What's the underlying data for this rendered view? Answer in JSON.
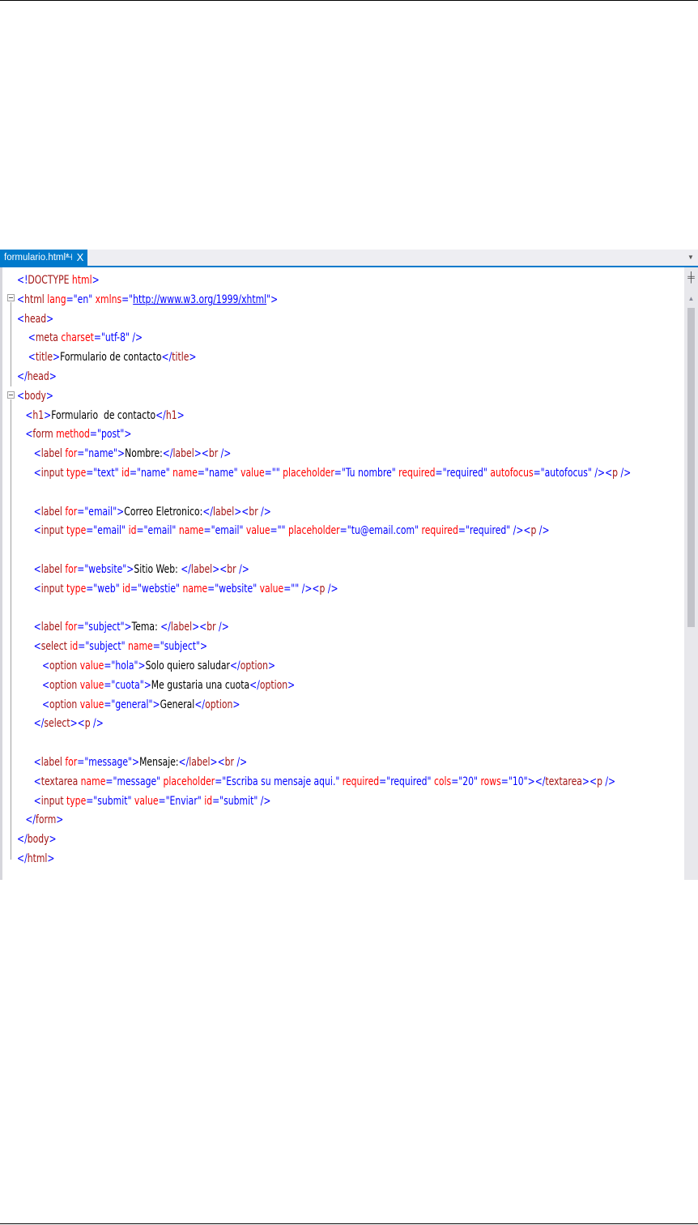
{
  "editor": {
    "tab": {
      "label": "formulario.html*",
      "pin_glyph": "⊣",
      "close_glyph": "X"
    },
    "tab_dropdown_glyph": "▼",
    "scrollbar": {
      "split_glyph": "╪",
      "up_glyph": "▲"
    }
  },
  "code_lines": [
    [
      [
        "p",
        "<!"
      ],
      [
        "t",
        "DOCTYPE"
      ],
      [
        "x",
        " "
      ],
      [
        "a",
        "html"
      ],
      [
        "p",
        ">"
      ]
    ],
    [
      [
        "p",
        "<"
      ],
      [
        "t",
        "html"
      ],
      [
        "x",
        " "
      ],
      [
        "a",
        "lang"
      ],
      [
        "p",
        "=\"en\""
      ],
      [
        "x",
        " "
      ],
      [
        "a",
        "xmlns"
      ],
      [
        "p",
        "=\""
      ],
      [
        "u",
        "http://www.w3.org/1999/xhtml"
      ],
      [
        "p",
        "\">"
      ]
    ],
    [
      [
        "p",
        "<"
      ],
      [
        "t",
        "head"
      ],
      [
        "p",
        ">"
      ]
    ],
    [
      [
        "x",
        "    "
      ],
      [
        "p",
        "<"
      ],
      [
        "t",
        "meta"
      ],
      [
        "x",
        " "
      ],
      [
        "a",
        "charset"
      ],
      [
        "p",
        "=\"utf-8\""
      ],
      [
        "x",
        " "
      ],
      [
        "p",
        "/>"
      ]
    ],
    [
      [
        "x",
        "    "
      ],
      [
        "p",
        "<"
      ],
      [
        "t",
        "title"
      ],
      [
        "p",
        ">"
      ],
      [
        "x",
        "Formulario de contacto"
      ],
      [
        "p",
        "</"
      ],
      [
        "t",
        "title"
      ],
      [
        "p",
        ">"
      ]
    ],
    [
      [
        "p",
        "</"
      ],
      [
        "t",
        "head"
      ],
      [
        "p",
        ">"
      ]
    ],
    [
      [
        "p",
        "<"
      ],
      [
        "t",
        "body"
      ],
      [
        "p",
        ">"
      ]
    ],
    [
      [
        "x",
        "   "
      ],
      [
        "p",
        "<"
      ],
      [
        "t",
        "h1"
      ],
      [
        "p",
        ">"
      ],
      [
        "x",
        "Formulario  de contacto"
      ],
      [
        "p",
        "</"
      ],
      [
        "t",
        "h1"
      ],
      [
        "p",
        ">"
      ]
    ],
    [
      [
        "x",
        "   "
      ],
      [
        "p",
        "<"
      ],
      [
        "t",
        "form"
      ],
      [
        "x",
        " "
      ],
      [
        "a",
        "method"
      ],
      [
        "p",
        "=\"post\">"
      ]
    ],
    [
      [
        "x",
        "      "
      ],
      [
        "p",
        "<"
      ],
      [
        "t",
        "label"
      ],
      [
        "x",
        " "
      ],
      [
        "a",
        "for"
      ],
      [
        "p",
        "=\"name\">"
      ],
      [
        "x",
        "Nombre:"
      ],
      [
        "p",
        "</"
      ],
      [
        "t",
        "label"
      ],
      [
        "p",
        "><"
      ],
      [
        "t",
        "br"
      ],
      [
        "x",
        " "
      ],
      [
        "p",
        "/>"
      ]
    ],
    [
      [
        "x",
        "      "
      ],
      [
        "p",
        "<"
      ],
      [
        "t",
        "input"
      ],
      [
        "x",
        " "
      ],
      [
        "a",
        "type"
      ],
      [
        "p",
        "=\"text\""
      ],
      [
        "x",
        " "
      ],
      [
        "a",
        "id"
      ],
      [
        "p",
        "=\"name\""
      ],
      [
        "x",
        " "
      ],
      [
        "a",
        "name"
      ],
      [
        "p",
        "=\"name\""
      ],
      [
        "x",
        " "
      ],
      [
        "a",
        "value"
      ],
      [
        "p",
        "=\"\""
      ],
      [
        "x",
        " "
      ],
      [
        "a",
        "placeholder"
      ],
      [
        "p",
        "=\"Tu nombre\""
      ],
      [
        "x",
        " "
      ],
      [
        "a",
        "required"
      ],
      [
        "p",
        "=\"required\""
      ],
      [
        "x",
        " "
      ],
      [
        "a",
        "autofocus"
      ],
      [
        "p",
        "=\"autofocus\""
      ],
      [
        "x",
        " "
      ],
      [
        "p",
        "/><"
      ],
      [
        "t",
        "p"
      ],
      [
        "x",
        " "
      ],
      [
        "p",
        "/>"
      ]
    ],
    [],
    [
      [
        "x",
        "      "
      ],
      [
        "p",
        "<"
      ],
      [
        "t",
        "label"
      ],
      [
        "x",
        " "
      ],
      [
        "a",
        "for"
      ],
      [
        "p",
        "=\"email\">"
      ],
      [
        "x",
        "Correo Eletronico:"
      ],
      [
        "p",
        "</"
      ],
      [
        "t",
        "label"
      ],
      [
        "p",
        "><"
      ],
      [
        "t",
        "br"
      ],
      [
        "x",
        " "
      ],
      [
        "p",
        "/>"
      ]
    ],
    [
      [
        "x",
        "      "
      ],
      [
        "p",
        "<"
      ],
      [
        "t",
        "input"
      ],
      [
        "x",
        " "
      ],
      [
        "a",
        "type"
      ],
      [
        "p",
        "=\"email\""
      ],
      [
        "x",
        " "
      ],
      [
        "a",
        "id"
      ],
      [
        "p",
        "=\"email\""
      ],
      [
        "x",
        " "
      ],
      [
        "a",
        "name"
      ],
      [
        "p",
        "=\"email\""
      ],
      [
        "x",
        " "
      ],
      [
        "a",
        "value"
      ],
      [
        "p",
        "=\"\""
      ],
      [
        "x",
        " "
      ],
      [
        "a",
        "placeholder"
      ],
      [
        "p",
        "=\"tu@email.com\""
      ],
      [
        "x",
        " "
      ],
      [
        "a",
        "required"
      ],
      [
        "p",
        "=\"required\""
      ],
      [
        "x",
        " "
      ],
      [
        "p",
        "/><"
      ],
      [
        "t",
        "p"
      ],
      [
        "x",
        " "
      ],
      [
        "p",
        "/>"
      ]
    ],
    [],
    [
      [
        "x",
        "      "
      ],
      [
        "p",
        "<"
      ],
      [
        "t",
        "label"
      ],
      [
        "x",
        " "
      ],
      [
        "a",
        "for"
      ],
      [
        "p",
        "=\"website\">"
      ],
      [
        "x",
        "Sitio Web: "
      ],
      [
        "p",
        "</"
      ],
      [
        "t",
        "label"
      ],
      [
        "p",
        "><"
      ],
      [
        "t",
        "br"
      ],
      [
        "x",
        " "
      ],
      [
        "p",
        "/>"
      ]
    ],
    [
      [
        "x",
        "      "
      ],
      [
        "p",
        "<"
      ],
      [
        "t",
        "input"
      ],
      [
        "x",
        " "
      ],
      [
        "a",
        "type"
      ],
      [
        "p",
        "=\"web\""
      ],
      [
        "x",
        " "
      ],
      [
        "a",
        "id"
      ],
      [
        "p",
        "=\"webstie\""
      ],
      [
        "x",
        " "
      ],
      [
        "a",
        "name"
      ],
      [
        "p",
        "=\"website\""
      ],
      [
        "x",
        " "
      ],
      [
        "a",
        "value"
      ],
      [
        "p",
        "=\"\""
      ],
      [
        "x",
        " "
      ],
      [
        "p",
        "/><"
      ],
      [
        "t",
        "p"
      ],
      [
        "x",
        " "
      ],
      [
        "p",
        "/>"
      ]
    ],
    [],
    [
      [
        "x",
        "      "
      ],
      [
        "p",
        "<"
      ],
      [
        "t",
        "label"
      ],
      [
        "x",
        " "
      ],
      [
        "a",
        "for"
      ],
      [
        "p",
        "=\"subject\">"
      ],
      [
        "x",
        "Tema: "
      ],
      [
        "p",
        "</"
      ],
      [
        "t",
        "label"
      ],
      [
        "p",
        "><"
      ],
      [
        "t",
        "br"
      ],
      [
        "x",
        " "
      ],
      [
        "p",
        "/>"
      ]
    ],
    [
      [
        "x",
        "      "
      ],
      [
        "p",
        "<"
      ],
      [
        "t",
        "select"
      ],
      [
        "x",
        " "
      ],
      [
        "a",
        "id"
      ],
      [
        "p",
        "=\"subject\""
      ],
      [
        "x",
        " "
      ],
      [
        "a",
        "name"
      ],
      [
        "p",
        "=\"subject\">"
      ]
    ],
    [
      [
        "x",
        "         "
      ],
      [
        "p",
        "<"
      ],
      [
        "t",
        "option"
      ],
      [
        "x",
        " "
      ],
      [
        "a",
        "value"
      ],
      [
        "p",
        "=\"hola\">"
      ],
      [
        "x",
        "Solo quiero saludar"
      ],
      [
        "p",
        "</"
      ],
      [
        "t",
        "option"
      ],
      [
        "p",
        ">"
      ]
    ],
    [
      [
        "x",
        "         "
      ],
      [
        "p",
        "<"
      ],
      [
        "t",
        "option"
      ],
      [
        "x",
        " "
      ],
      [
        "a",
        "value"
      ],
      [
        "p",
        "=\"cuota\">"
      ],
      [
        "x",
        "Me gustaria una cuota"
      ],
      [
        "p",
        "</"
      ],
      [
        "t",
        "option"
      ],
      [
        "p",
        ">"
      ]
    ],
    [
      [
        "x",
        "         "
      ],
      [
        "p",
        "<"
      ],
      [
        "t",
        "option"
      ],
      [
        "x",
        " "
      ],
      [
        "a",
        "value"
      ],
      [
        "p",
        "=\"general\">"
      ],
      [
        "x",
        "General"
      ],
      [
        "p",
        "</"
      ],
      [
        "t",
        "option"
      ],
      [
        "p",
        ">"
      ]
    ],
    [
      [
        "x",
        "      "
      ],
      [
        "p",
        "</"
      ],
      [
        "t",
        "select"
      ],
      [
        "p",
        "><"
      ],
      [
        "t",
        "p"
      ],
      [
        "x",
        " "
      ],
      [
        "p",
        "/>"
      ]
    ],
    [],
    [
      [
        "x",
        "      "
      ],
      [
        "p",
        "<"
      ],
      [
        "t",
        "label"
      ],
      [
        "x",
        " "
      ],
      [
        "a",
        "for"
      ],
      [
        "p",
        "=\"message\">"
      ],
      [
        "x",
        "Mensaje:"
      ],
      [
        "p",
        "</"
      ],
      [
        "t",
        "label"
      ],
      [
        "p",
        "><"
      ],
      [
        "t",
        "br"
      ],
      [
        "x",
        " "
      ],
      [
        "p",
        "/>"
      ]
    ],
    [
      [
        "x",
        "      "
      ],
      [
        "p",
        "<"
      ],
      [
        "t",
        "textarea"
      ],
      [
        "x",
        " "
      ],
      [
        "a",
        "name"
      ],
      [
        "p",
        "=\"message\""
      ],
      [
        "x",
        " "
      ],
      [
        "a",
        "placeholder"
      ],
      [
        "p",
        "=\"Escriba su mensaje aqui.\""
      ],
      [
        "x",
        " "
      ],
      [
        "a",
        "required"
      ],
      [
        "p",
        "=\"required\""
      ],
      [
        "x",
        " "
      ],
      [
        "a",
        "cols"
      ],
      [
        "p",
        "=\"20\""
      ],
      [
        "x",
        " "
      ],
      [
        "a",
        "rows"
      ],
      [
        "p",
        "=\"10\">"
      ],
      [
        "p",
        "</"
      ],
      [
        "t",
        "textarea"
      ],
      [
        "p",
        "><"
      ],
      [
        "t",
        "p"
      ],
      [
        "x",
        " "
      ],
      [
        "p",
        "/>"
      ]
    ],
    [
      [
        "x",
        "      "
      ],
      [
        "p",
        "<"
      ],
      [
        "t",
        "input"
      ],
      [
        "x",
        " "
      ],
      [
        "a",
        "type"
      ],
      [
        "p",
        "=\"submit\""
      ],
      [
        "x",
        " "
      ],
      [
        "a",
        "value"
      ],
      [
        "p",
        "=\"Enviar\""
      ],
      [
        "x",
        " "
      ],
      [
        "a",
        "id"
      ],
      [
        "p",
        "=\"submit\""
      ],
      [
        "x",
        " "
      ],
      [
        "p",
        "/>"
      ]
    ],
    [
      [
        "x",
        "   "
      ],
      [
        "p",
        "</"
      ],
      [
        "t",
        "form"
      ],
      [
        "p",
        ">"
      ]
    ],
    [
      [
        "p",
        "</"
      ],
      [
        "t",
        "body"
      ],
      [
        "p",
        ">"
      ]
    ],
    [
      [
        "p",
        "</"
      ],
      [
        "t",
        "html"
      ],
      [
        "p",
        ">"
      ]
    ]
  ]
}
